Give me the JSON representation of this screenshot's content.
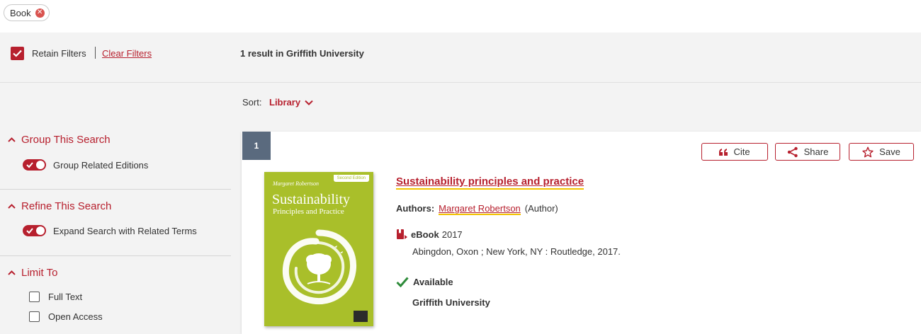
{
  "active_filters": [
    {
      "label": "Book"
    }
  ],
  "filter_bar": {
    "retain_label": "Retain Filters",
    "clear_label": "Clear Filters",
    "result_count": "1 result in Griffith University"
  },
  "sort": {
    "label": "Sort:",
    "value": "Library"
  },
  "sidebar": {
    "group": {
      "heading": "Group This Search",
      "toggle_label": "Group Related Editions",
      "enabled": true
    },
    "refine": {
      "heading": "Refine This Search",
      "toggle_label": "Expand Search with Related Terms",
      "enabled": true
    },
    "limit": {
      "heading": "Limit To",
      "options": [
        {
          "label": "Full Text",
          "checked": false
        },
        {
          "label": "Open Access",
          "checked": false
        }
      ]
    }
  },
  "result": {
    "index": "1",
    "actions": {
      "cite": "Cite",
      "share": "Share",
      "save": "Save"
    },
    "cover": {
      "author": "Margaret Robertson",
      "edition": "Second Edition",
      "title": "Sustainability",
      "subtitle": "Principles and Practice"
    },
    "title": "Sustainability principles and practice",
    "authors_label": "Authors:",
    "author_name": "Margaret Robertson",
    "author_role": "(Author)",
    "format": "eBook",
    "year": "2017",
    "publication": "Abingdon, Oxon ; New York, NY : Routledge, 2017.",
    "availability": "Available",
    "library": "Griffith University"
  },
  "colors": {
    "accent": "#b7202e",
    "highlight": "#f2c300",
    "available": "#2e8b3a",
    "cover": "#a9bf2a",
    "index_badge": "#5a6a7e"
  }
}
